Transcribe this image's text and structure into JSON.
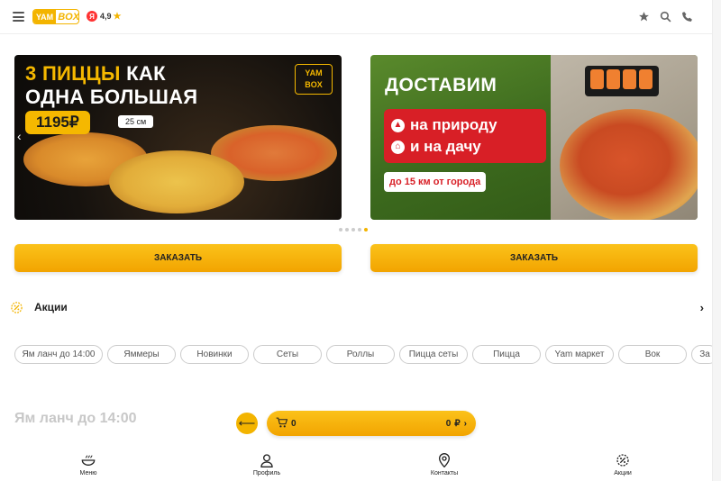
{
  "header": {
    "logo_yam": "YAM",
    "logo_box": "BOX",
    "rating_badge": "Я",
    "rating_value": "4,9",
    "icons": [
      "menu-icon",
      "star-icon",
      "search-icon",
      "phone-icon"
    ]
  },
  "banners": [
    {
      "title_line1_accent": "3 ПИЦЦЫ",
      "title_line1_rest": " КАК",
      "title_line2": "ОДНА БОЛЬШАЯ",
      "price": "1195₽",
      "size": "25 см",
      "logo_line1": "YAM",
      "logo_line2": "BOX",
      "order_label": "ЗАКАЗАТЬ"
    },
    {
      "title": "ДОСТАВИМ",
      "line1": "на природу",
      "line2": "и на дачу",
      "distance": "до 15 км от города",
      "order_label": "ЗАКАЗАТЬ"
    }
  ],
  "carousel": {
    "dots": 5,
    "active": 4
  },
  "promo": {
    "label": "Акции"
  },
  "categories": [
    "Ям ланч до 14:00",
    "Яммеры",
    "Новинки",
    "Сеты",
    "Роллы",
    "Пицца сеты",
    "Пицца",
    "Yam маркет",
    "Вок",
    "За"
  ],
  "section_title": "Ям ланч до 14:00",
  "cart": {
    "count": "0",
    "sum": "0",
    "currency": "₽"
  },
  "bottom_nav": [
    {
      "label": "Меню",
      "icon": "bowl-icon"
    },
    {
      "label": "Профиль",
      "icon": "user-icon"
    },
    {
      "label": "Контакты",
      "icon": "location-icon"
    },
    {
      "label": "Акции",
      "icon": "discount-icon"
    }
  ],
  "colors": {
    "accent": "#f3b400",
    "red": "#d81f26"
  }
}
